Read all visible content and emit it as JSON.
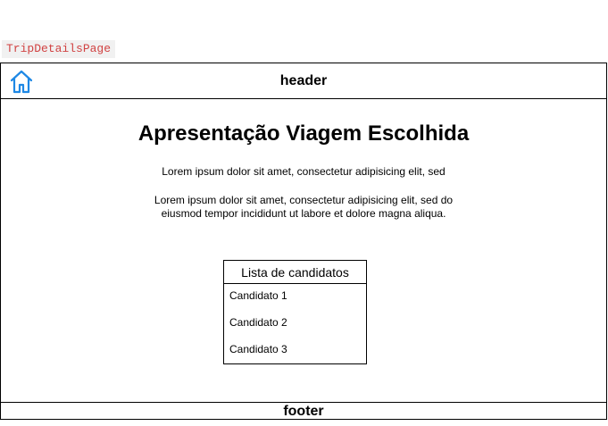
{
  "page_label": "TripDetailsPage",
  "header": {
    "title": "header",
    "icon": "home-icon",
    "icon_color": "#1e88e5"
  },
  "main": {
    "title": "Apresentação Viagem Escolhida",
    "paragraph_1": "Lorem ipsum dolor sit amet, consectetur adipisicing elit, sed",
    "paragraph_2": "Lorem ipsum dolor sit amet, consectetur adipisicing elit, sed do eiusmod tempor incididunt ut labore et dolore magna aliqua."
  },
  "candidates": {
    "title": "Lista de candidatos",
    "items": [
      "Candidato 1",
      "Candidato 2",
      "Candidato 3"
    ]
  },
  "footer": {
    "title": "footer"
  }
}
